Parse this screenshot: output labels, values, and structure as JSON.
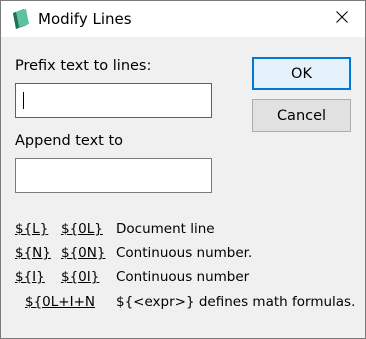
{
  "window": {
    "title": "Modify Lines",
    "close_glyph": "✕"
  },
  "form": {
    "prefix_label": "Prefix text to lines:",
    "prefix_value": "",
    "append_label": "Append text to",
    "append_value": ""
  },
  "buttons": {
    "ok": "OK",
    "cancel": "Cancel"
  },
  "variables": [
    {
      "a": "${L}",
      "b": "${0L}",
      "desc": "Document line"
    },
    {
      "a": "${N}",
      "b": "${0N}",
      "desc": "Continuous number."
    },
    {
      "a": "${I}",
      "b": "${0I}",
      "desc": "Continuous number"
    }
  ],
  "formula_row": {
    "var": "${0L+I+N",
    "desc": "${<expr>} defines math formulas."
  },
  "colors": {
    "accent": "#0078d7",
    "dialog_bg": "#f0f0f0",
    "icon_green": "#3fa98a"
  }
}
